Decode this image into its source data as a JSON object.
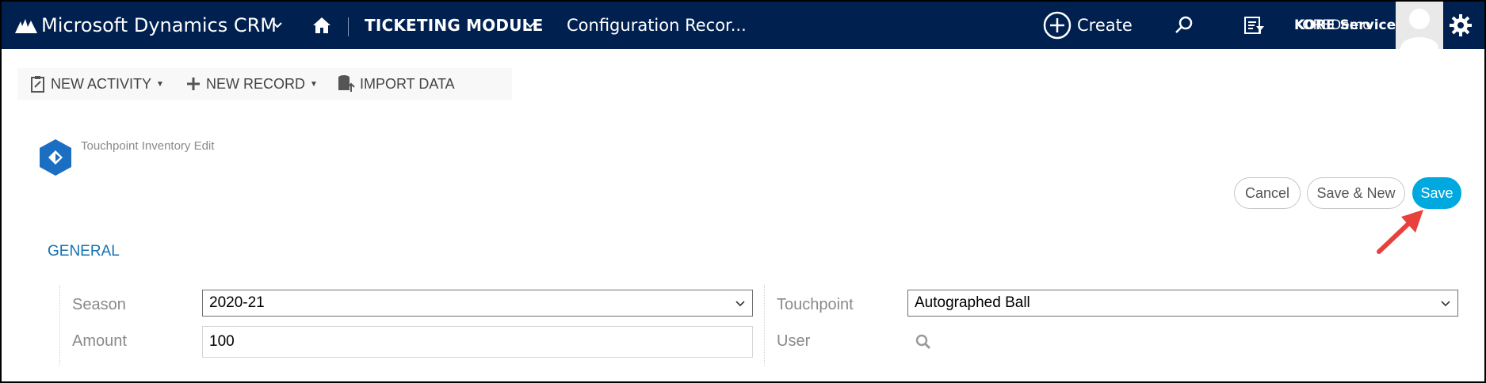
{
  "topbar": {
    "app_title": "Microsoft Dynamics CRM",
    "module": "TICKETING MODULE",
    "breadcrumb": "Configuration Recor...",
    "create_label": "Create",
    "user_name": "KORE Service",
    "user_org": "KOREDemo",
    "background": "#002050"
  },
  "commandbar": {
    "new_activity": "NEW ACTIVITY",
    "new_record": "NEW RECORD",
    "import_data": "IMPORT DATA"
  },
  "form": {
    "title": "Touchpoint Inventory Edit",
    "buttons": {
      "cancel": "Cancel",
      "save_new": "Save & New",
      "save": "Save"
    },
    "save_color": "#00a8e0",
    "section_title": "GENERAL",
    "fields": {
      "season_label": "Season",
      "season_value": "2020-21",
      "amount_label": "Amount",
      "amount_value": "100",
      "touchpoint_label": "Touchpoint",
      "touchpoint_value": "Autographed Ball",
      "user_label": "User"
    }
  },
  "icons": [
    "dynamics-logo-icon",
    "chevron-down-icon",
    "home-icon",
    "create-plus-icon",
    "search-icon",
    "advanced-find-icon",
    "avatar",
    "gear-icon",
    "new-activity-icon",
    "new-record-icon",
    "import-data-icon",
    "entity-icon",
    "lookup-search-icon",
    "annotation-arrow"
  ]
}
